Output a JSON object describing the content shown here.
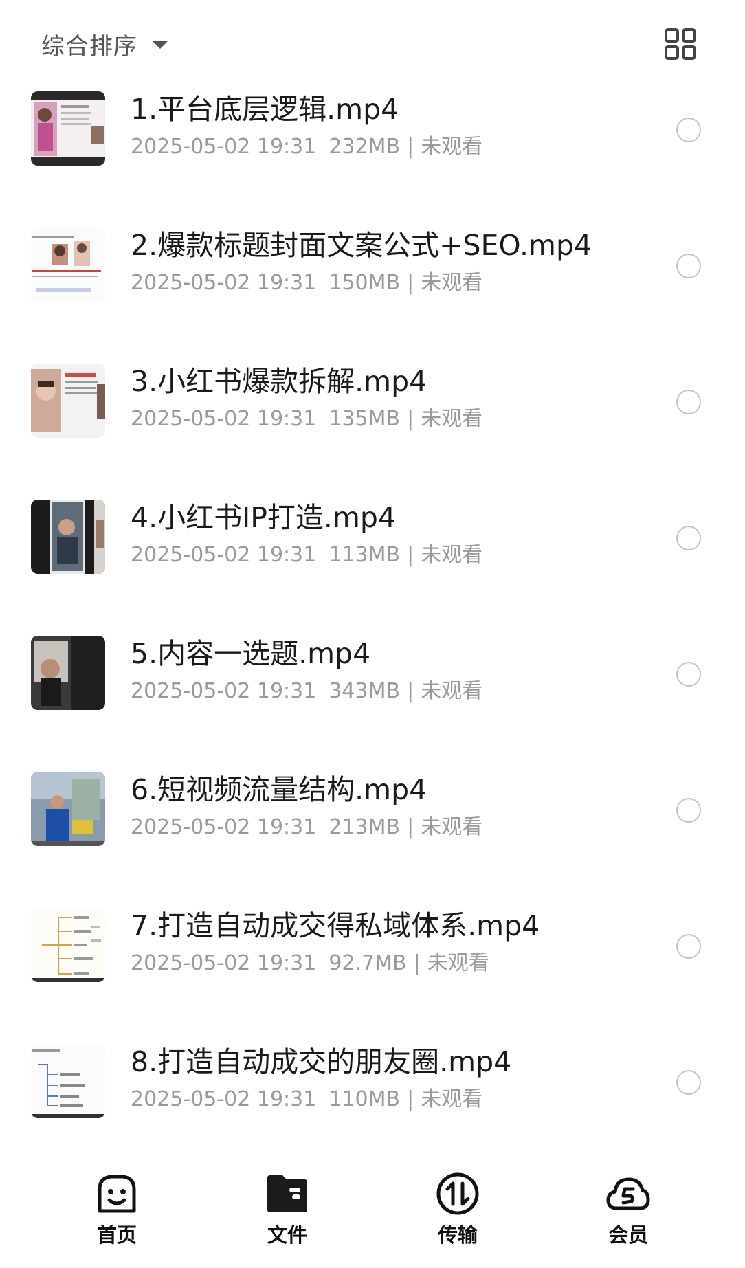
{
  "toolbar": {
    "sort_label": "综合排序",
    "sort_icon": "caret-down-icon",
    "view_toggle_icon": "grid-view-icon"
  },
  "files": [
    {
      "title": "1.平台底层逻辑.mp4",
      "date": "2025-05-02 19:31",
      "size": "232MB",
      "status": "未观看"
    },
    {
      "title": "2.爆款标题封面文案公式+SEO.mp4",
      "date": "2025-05-02 19:31",
      "size": "150MB",
      "status": "未观看"
    },
    {
      "title": "3.小红书爆款拆解.mp4",
      "date": "2025-05-02 19:31",
      "size": "135MB",
      "status": "未观看"
    },
    {
      "title": "4.小红书IP打造.mp4",
      "date": "2025-05-02 19:31",
      "size": "113MB",
      "status": "未观看"
    },
    {
      "title": "5.内容一选题.mp4",
      "date": "2025-05-02 19:31",
      "size": "343MB",
      "status": "未观看"
    },
    {
      "title": "6.短视频流量结构.mp4",
      "date": "2025-05-02 19:31",
      "size": "213MB",
      "status": "未观看"
    },
    {
      "title": "7.打造自动成交得私域体系.mp4",
      "date": "2025-05-02 19:31",
      "size": "92.7MB",
      "status": "未观看"
    },
    {
      "title": "8.打造自动成交的朋友圈.mp4",
      "date": "2025-05-02 19:31",
      "size": "110MB",
      "status": "未观看"
    }
  ],
  "tabs": [
    {
      "label": "首页",
      "icon": "smiley-home-icon",
      "active": false
    },
    {
      "label": "文件",
      "icon": "folder-icon",
      "active": true
    },
    {
      "label": "传输",
      "icon": "transfer-icon",
      "active": false
    },
    {
      "label": "会员",
      "icon": "cloud-vip-icon",
      "active": false
    }
  ],
  "colors": {
    "text_primary": "#1a1a1a",
    "text_secondary": "#9a9a9a",
    "radio_border": "#c4c4c4",
    "tab_icon": "#111111"
  }
}
